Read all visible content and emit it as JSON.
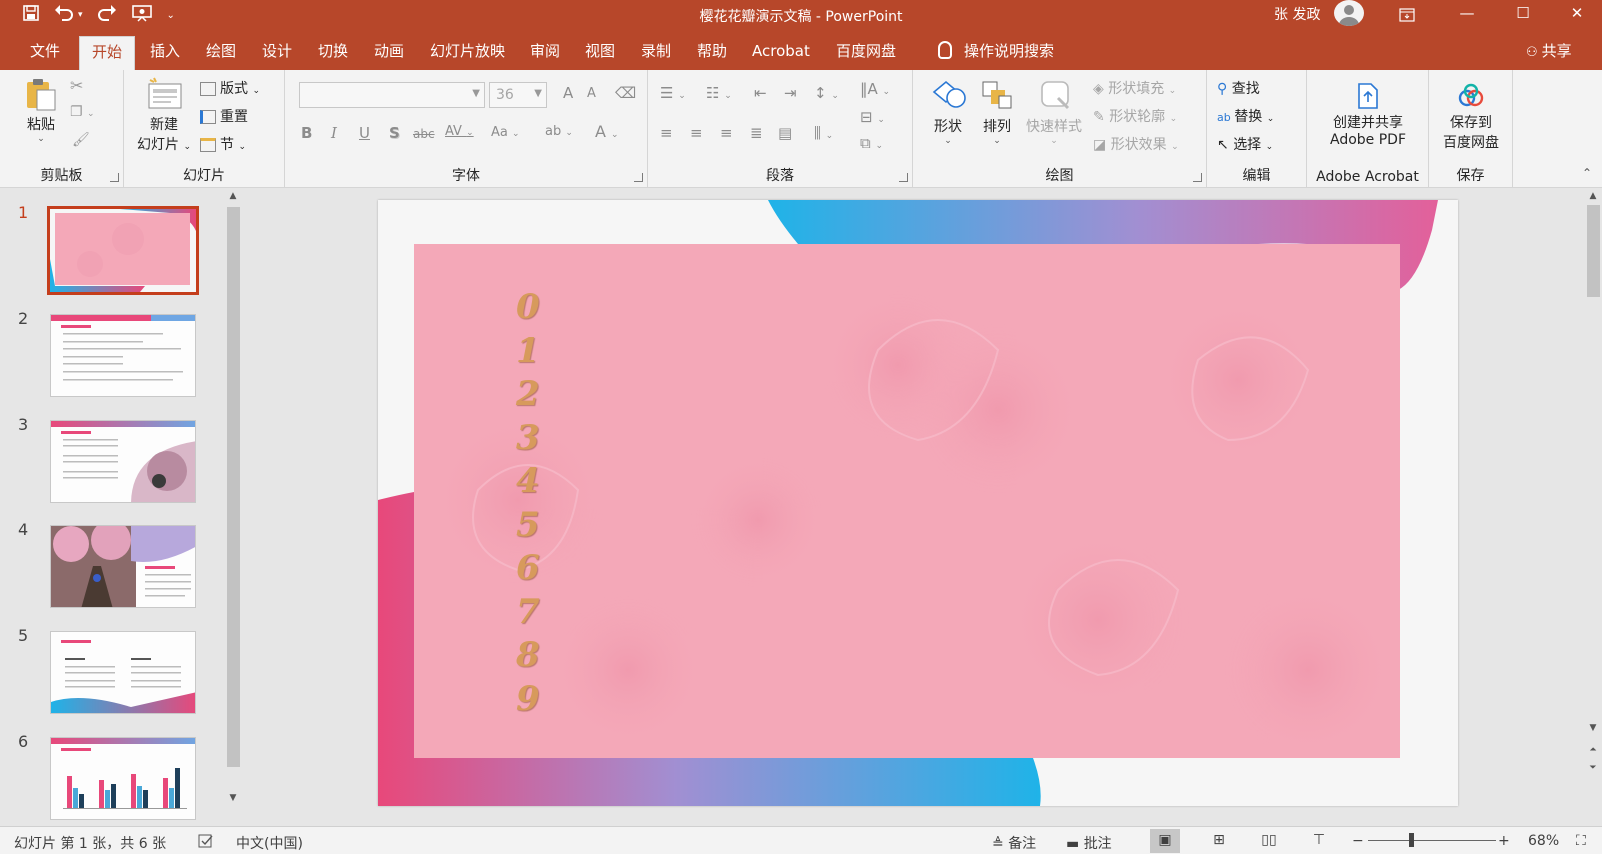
{
  "window": {
    "title": "樱花花瓣演示文稿  -  PowerPoint",
    "user": "张 发政",
    "qat": {
      "save": "save-icon",
      "undo": "undo-icon",
      "redo": "redo-icon",
      "present": "present-icon",
      "customize": "customize-icon"
    },
    "controls": {
      "restore_ribbon": "▭",
      "minimize": "—",
      "maximize": "☐",
      "close": "✕"
    }
  },
  "tabs": [
    {
      "label": "文件"
    },
    {
      "label": "开始",
      "active": true
    },
    {
      "label": "插入"
    },
    {
      "label": "绘图"
    },
    {
      "label": "设计"
    },
    {
      "label": "切换"
    },
    {
      "label": "动画"
    },
    {
      "label": "幻灯片放映"
    },
    {
      "label": "审阅"
    },
    {
      "label": "视图"
    },
    {
      "label": "录制"
    },
    {
      "label": "帮助"
    },
    {
      "label": "Acrobat"
    },
    {
      "label": "百度网盘"
    }
  ],
  "tell_me": "操作说明搜索",
  "share": "共享",
  "ribbon": {
    "clipboard": {
      "label": "剪贴板",
      "paste": "粘贴"
    },
    "slides": {
      "label": "幻灯片",
      "new_slide_line1": "新建",
      "new_slide_line2": "幻灯片",
      "layout": "版式",
      "reset": "重置",
      "section": "节"
    },
    "font": {
      "label": "字体",
      "font_name": "",
      "font_size": "36",
      "buttons": {
        "bold": "B",
        "italic": "I",
        "underline": "U",
        "shadow": "S",
        "strike": "abc",
        "spacing": "AV",
        "case": "Aa",
        "grow": "A",
        "shrink": "A",
        "color": "A"
      }
    },
    "paragraph": {
      "label": "段落"
    },
    "drawing": {
      "label": "绘图",
      "shapes": "形状",
      "arrange": "排列",
      "quick_styles": "快速样式",
      "shape_fill": "形状填充",
      "shape_outline": "形状轮廓",
      "shape_effects": "形状效果"
    },
    "editing": {
      "label": "编辑",
      "find": "查找",
      "replace": "替换",
      "select": "选择"
    },
    "acrobat": {
      "label": "Adobe Acrobat",
      "create_line1": "创建并共享",
      "create_line2": "Adobe PDF"
    },
    "save": {
      "label": "保存",
      "save_line1": "保存到",
      "save_line2": "百度网盘"
    }
  },
  "thumbnails": [
    {
      "num": "1",
      "selected": true
    },
    {
      "num": "2"
    },
    {
      "num": "3"
    },
    {
      "num": "4"
    },
    {
      "num": "5"
    },
    {
      "num": "6"
    }
  ],
  "slide": {
    "digits": [
      "0",
      "1",
      "2",
      "3",
      "4",
      "5",
      "6",
      "7",
      "8",
      "9"
    ],
    "colors": {
      "pink": "#f4a8b8",
      "gradient_start": "#1fb3e8",
      "gradient_mid": "#a18fd2",
      "gradient_end": "#e8487a",
      "digit": "#d79a5c"
    }
  },
  "status": {
    "slide_info": "幻灯片 第 1 张，共 6 张",
    "language": "中文(中国)",
    "notes": "备注",
    "comments": "批注",
    "zoom": "68%",
    "zoom_minus": "−",
    "zoom_plus": "+"
  },
  "accent": "#b7472a"
}
